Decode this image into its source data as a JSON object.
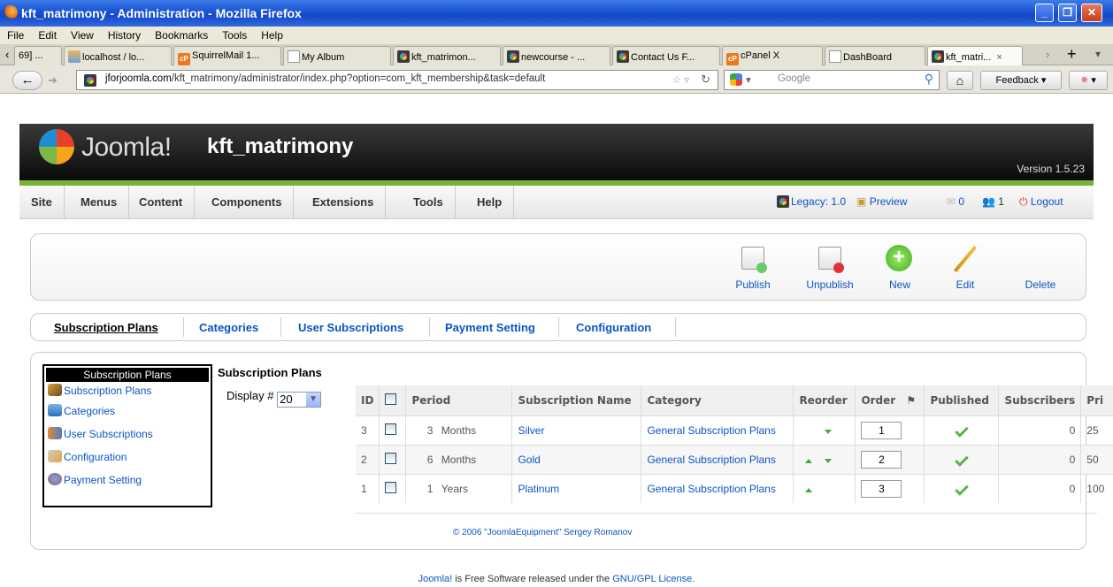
{
  "window": {
    "title": "kft_matrimony - Administration - Mozilla Firefox"
  },
  "menubar": [
    "File",
    "Edit",
    "View",
    "History",
    "Bookmarks",
    "Tools",
    "Help"
  ],
  "tabs": [
    {
      "label": "69] ...",
      "icon": "none"
    },
    {
      "label": "localhost / lo...",
      "icon": "phpmyadmin-icon"
    },
    {
      "label": "SquirrelMail 1...",
      "icon": "cpanel-icon"
    },
    {
      "label": "My Album",
      "icon": "blank-page-icon"
    },
    {
      "label": "kft_matrimon...",
      "icon": "joomla-icon"
    },
    {
      "label": "newcourse - ...",
      "icon": "joomla-icon"
    },
    {
      "label": "Contact Us F...",
      "icon": "joomla-icon"
    },
    {
      "label": "cPanel X",
      "icon": "cpanel-icon"
    },
    {
      "label": "DashBoard",
      "icon": "blank-page-icon"
    },
    {
      "label": "kft_matri...",
      "icon": "joomla-icon"
    }
  ],
  "nav": {
    "url_host": "jforjoomla.com",
    "url_path": "/kft_matrimony/administrator/index.php?option=com_kft_membership&task=default",
    "search_placeholder": "Google",
    "feedback_label": "Feedback"
  },
  "header": {
    "brand": "Joomla!",
    "site_name": "kft_matrimony",
    "version": "Version 1.5.23"
  },
  "admin_menu": {
    "items": [
      "Site",
      "Menus",
      "Content",
      "Components",
      "Extensions",
      "Tools",
      "Help"
    ],
    "legacy": "Legacy: 1.0",
    "preview": "Preview",
    "messages": "0",
    "users": "1",
    "logout": "Logout"
  },
  "toolbar": {
    "publish": "Publish",
    "unpublish": "Unpublish",
    "new": "New",
    "edit": "Edit",
    "delete": "Delete"
  },
  "submenu": [
    "Subscription Plans",
    "Categories",
    "User Subscriptions",
    "Payment Setting",
    "Configuration"
  ],
  "leftpanel": {
    "heading": "Subscription Plans",
    "items": [
      "Subscription Plans",
      "Categories",
      "User Subscriptions",
      "Configuration",
      "Payment Setting"
    ]
  },
  "main": {
    "heading": "Subscription Plans",
    "display_label": "Display #",
    "display_value": "20"
  },
  "table": {
    "headers": [
      "ID",
      "Period",
      "Subscription Name",
      "Category",
      "Reorder",
      "Order",
      "Published",
      "Subscribers",
      "Pri"
    ],
    "rows": [
      {
        "id": "3",
        "period_num": "3",
        "period_unit": "Months",
        "name": "Silver",
        "category": "General Subscription Plans",
        "order": "1",
        "subscribers": "0",
        "price": "25",
        "up": false,
        "down": true
      },
      {
        "id": "2",
        "period_num": "6",
        "period_unit": "Months",
        "name": "Gold",
        "category": "General Subscription Plans",
        "order": "2",
        "subscribers": "0",
        "price": "50",
        "up": true,
        "down": true
      },
      {
        "id": "1",
        "period_num": "1",
        "period_unit": "Years",
        "name": "Platinum",
        "category": "General Subscription Plans",
        "order": "3",
        "subscribers": "0",
        "price": "100",
        "up": true,
        "down": false
      }
    ]
  },
  "copyright": "© 2006 \"JoomlaEquipment\" Sergey Romanov",
  "footer": {
    "pre": "Joomla!",
    "mid": " is Free Software released under the ",
    "link": "GNU/GPL License",
    "post": "."
  }
}
